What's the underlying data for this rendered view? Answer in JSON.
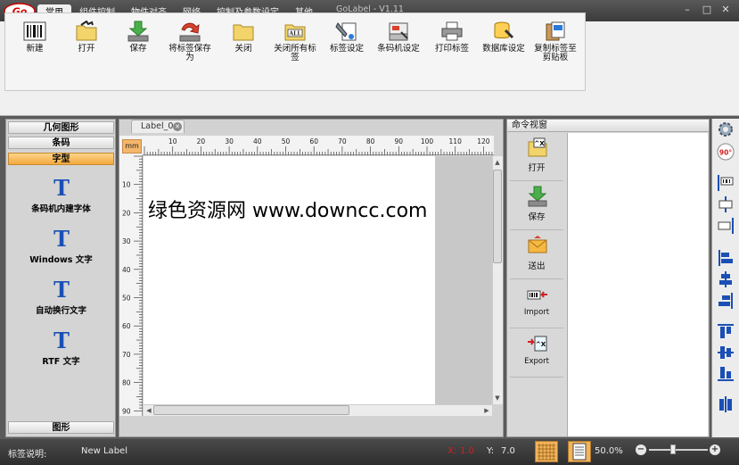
{
  "app": {
    "title": "GoLabel - V1.11",
    "logo": "Go"
  },
  "menu_tabs": [
    "常用",
    "组件控制",
    "物件对齐",
    "网络",
    "控制及参数设定",
    "其他"
  ],
  "ribbon": {
    "buttons": [
      {
        "id": "new",
        "label": "新建",
        "icon": "barcode-new-icon"
      },
      {
        "id": "open",
        "label": "打开",
        "icon": "folder-open-icon"
      },
      {
        "id": "save",
        "label": "保存",
        "icon": "save-icon"
      },
      {
        "id": "save-label",
        "label": "将标签保存为",
        "icon": "save-as-icon"
      },
      {
        "id": "close",
        "label": "关闭",
        "icon": "folder-close-icon"
      },
      {
        "id": "close-all",
        "label": "关闭所有标签",
        "icon": "close-all-icon"
      },
      {
        "id": "label-setting",
        "label": "标签设定",
        "icon": "label-setting-icon"
      },
      {
        "id": "printer-setting",
        "label": "条码机设定",
        "icon": "printer-setting-icon"
      },
      {
        "id": "print-label",
        "label": "打印标签",
        "icon": "printer-icon"
      },
      {
        "id": "db-setting",
        "label": "数据库设定",
        "icon": "database-icon"
      },
      {
        "id": "copy-clipboard",
        "label": "复制标签至剪贴板",
        "icon": "clipboard-icon"
      }
    ]
  },
  "left_panel": {
    "headers": [
      "几何图形",
      "条码",
      "字型",
      "图形"
    ],
    "items": [
      {
        "label": "条码机内建字体",
        "icon": "printer-font-icon"
      },
      {
        "label": "Windows 文字",
        "icon": "windows-text-icon"
      },
      {
        "label": "自动换行文字",
        "icon": "wrap-text-icon"
      },
      {
        "label": "RTF 文字",
        "icon": "rtf-text-icon"
      }
    ]
  },
  "document": {
    "tab_label": "Label_0",
    "unit": "mm",
    "content_text": "绿色资源网 www.downcc.com"
  },
  "ruler_h": [
    "10",
    "20",
    "30",
    "40",
    "50",
    "60",
    "70",
    "80",
    "90",
    "100",
    "110",
    "120"
  ],
  "ruler_v": [
    "10",
    "20",
    "30",
    "40",
    "50",
    "60",
    "70",
    "80",
    "90"
  ],
  "command_view": {
    "title": "命令视窗",
    "buttons": [
      {
        "label": "打开",
        "icon": "open-command-icon"
      },
      {
        "label": "保存",
        "icon": "save-command-icon"
      },
      {
        "label": "送出",
        "icon": "send-command-icon"
      },
      {
        "label": "Import",
        "icon": "import-icon"
      },
      {
        "label": "Export",
        "icon": "export-icon"
      }
    ]
  },
  "right_toolbar": {
    "rotate_label": "90°"
  },
  "status": {
    "label_desc_title": "标签说明:",
    "label_desc_value": "New Label",
    "x_label": "X:",
    "x_value": "1.0",
    "y_label": "Y:",
    "y_value": "7.0",
    "zoom": "50.0%"
  },
  "colors": {
    "accent_orange": "#f3a93e",
    "text_blue": "#1b4fb5",
    "coord_red": "#d22020"
  }
}
